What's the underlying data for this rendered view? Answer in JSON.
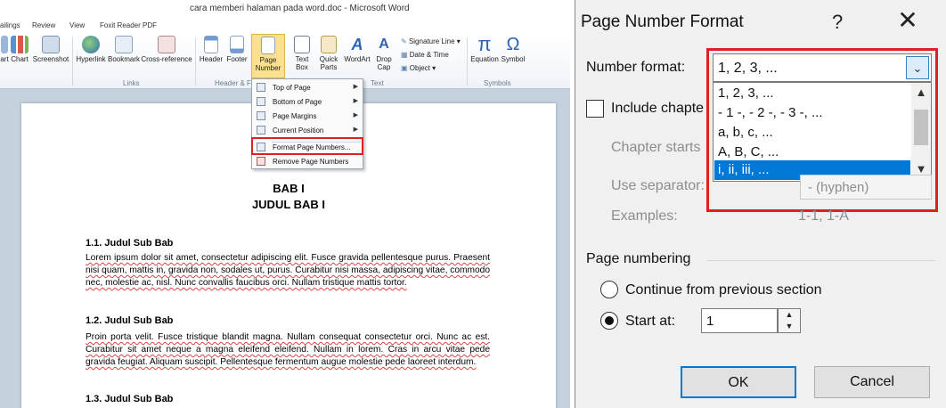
{
  "word": {
    "title_bar": "cara memberi halaman pada word.doc - Microsoft Word",
    "tabs": [
      "ailings",
      "Review",
      "View",
      "Foxit Reader PDF"
    ],
    "ribbon": {
      "art": "art",
      "chart": "Chart",
      "screenshot": "Screenshot",
      "hyperlink": "Hyperlink",
      "bookmark": "Bookmark",
      "cross_reference": "Cross-reference",
      "header": "Header",
      "footer": "Footer",
      "page_number_1": "Page",
      "page_number_2": "Number",
      "text_box_1": "Text",
      "text_box_2": "Box",
      "quick_parts_1": "Quick",
      "quick_parts_2": "Parts",
      "wordart": "WordArt",
      "drop_cap_1": "Drop",
      "drop_cap_2": "Cap",
      "signature_line": "Signature Line",
      "date_time": "Date & Time",
      "object": "Object",
      "equation": "Equation",
      "symbol": "Symbol",
      "groups": {
        "links": "Links",
        "header_footer": "Header & F",
        "text": "Text",
        "symbols": "Symbols"
      }
    },
    "page_number_menu": [
      {
        "label": "Top of Page",
        "submenu": true
      },
      {
        "label": "Bottom of Page",
        "submenu": true
      },
      {
        "label": "Page Margins",
        "submenu": true
      },
      {
        "label": "Current Position",
        "submenu": true
      },
      {
        "label": "Format Page Numbers...",
        "submenu": false
      },
      {
        "label": "Remove Page Numbers",
        "submenu": false
      }
    ],
    "document": {
      "heading1": "BAB I",
      "heading2": "JUDUL BAB I",
      "sections": [
        {
          "title": "1.1.   Judul Sub Bab",
          "text": "Lorem ipsum dolor sit amet, consectetur adipiscing elit. Fusce gravida pellentesque purus. Praesent nisi quam, mattis in, gravida non, sodales ut, purus. Curabitur nisi massa, adipiscing vitae, commodo nec, molestie ac, nisl. Nunc convallis faucibus orci. Nullam tristique mattis tortor."
        },
        {
          "title": "1.2.   Judul Sub Bab",
          "text": "Proin porta velit. Fusce tristique blandit magna. Nullam consequat consectetur orci. Nunc ac est. Curabitur sit amet neque a magna eleifend eleifend. Nullam in lorem. Cras in arcu vitae pede gravida feugiat. Aliquam suscipit. Pellentesque fermentum augue molestie pede laoreet interdum."
        },
        {
          "title": "1.3.   Judul Sub Bab",
          "text": ""
        }
      ]
    }
  },
  "dialog": {
    "title": "Page Number Format",
    "help": "?",
    "close": "✕",
    "number_format_label": "Number format:",
    "number_format_value": "1, 2, 3, ...",
    "number_format_options": [
      "1, 2, 3, ...",
      "- 1 -, - 2 -, - 3 -, ...",
      "a, b, c, ...",
      "A, B, C, ...",
      "i, ii, iii, ..."
    ],
    "selected_option_index": 4,
    "include_chapter": "Include chapte",
    "chapter_starts": "Chapter starts",
    "use_separator": "Use separator:",
    "separator_value": "-   (hyphen)",
    "examples_label": "Examples:",
    "examples_value": "1-1, 1-A",
    "page_numbering": "Page numbering",
    "continue_label": "Continue from previous section",
    "start_at_label": "Start at:",
    "start_at_value": "1",
    "ok": "OK",
    "cancel": "Cancel"
  },
  "colors": {
    "highlight_red": "#e02020",
    "selection_blue": "#0078d7"
  }
}
